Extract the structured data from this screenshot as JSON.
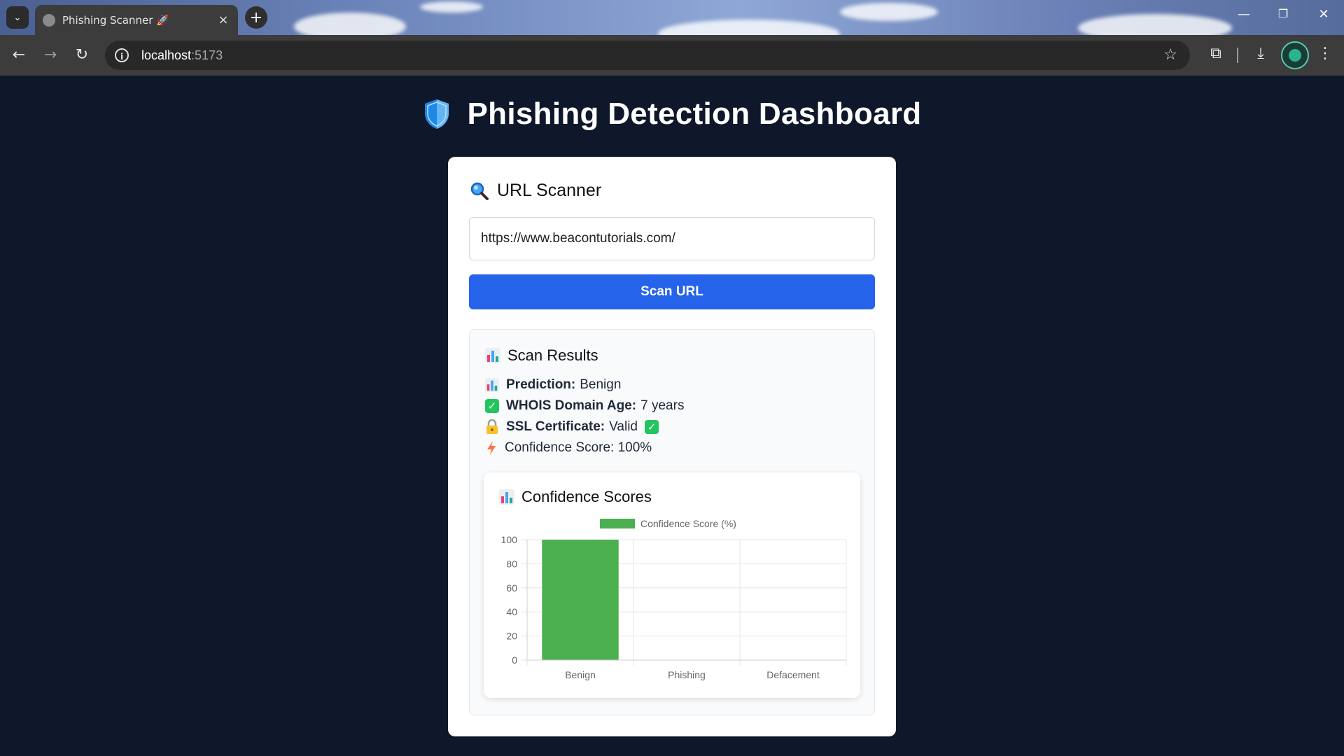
{
  "browser": {
    "tab_title": "Phishing Scanner 🚀",
    "url_host": "localhost",
    "url_port": ":5173"
  },
  "page": {
    "title": "Phishing Detection Dashboard"
  },
  "scanner": {
    "heading": "URL Scanner",
    "input_value": "https://www.beacontutorials.com/",
    "button_label": "Scan URL"
  },
  "results": {
    "heading": "Scan Results",
    "prediction_label": "Prediction:",
    "prediction_value": "Benign",
    "whois_label": "WHOIS Domain Age:",
    "whois_value": "7 years",
    "ssl_label": "SSL Certificate:",
    "ssl_value": "Valid",
    "confidence_text": "Confidence Score: 100%"
  },
  "chart_data": {
    "type": "bar",
    "title": "Confidence Scores",
    "categories": [
      "Benign",
      "Phishing",
      "Defacement"
    ],
    "series": [
      {
        "name": "Confidence Score (%)",
        "values": [
          100,
          0,
          0
        ],
        "color": "#4caf50"
      }
    ],
    "ylim": [
      0,
      100
    ],
    "yticks": [
      0,
      20,
      40,
      60,
      80,
      100
    ],
    "grid": true,
    "legend": "top"
  },
  "colors": {
    "page_bg": "#0f172a",
    "primary_button": "#2563eb",
    "bar": "#4caf50",
    "check": "#22c55e"
  },
  "icons": {
    "shield": "shield-icon",
    "scanner": "magnifier-icon",
    "results": "bar-chart-icon",
    "whois": "check-box-icon",
    "ssl": "lock-icon",
    "confidence": "lightning-icon"
  }
}
